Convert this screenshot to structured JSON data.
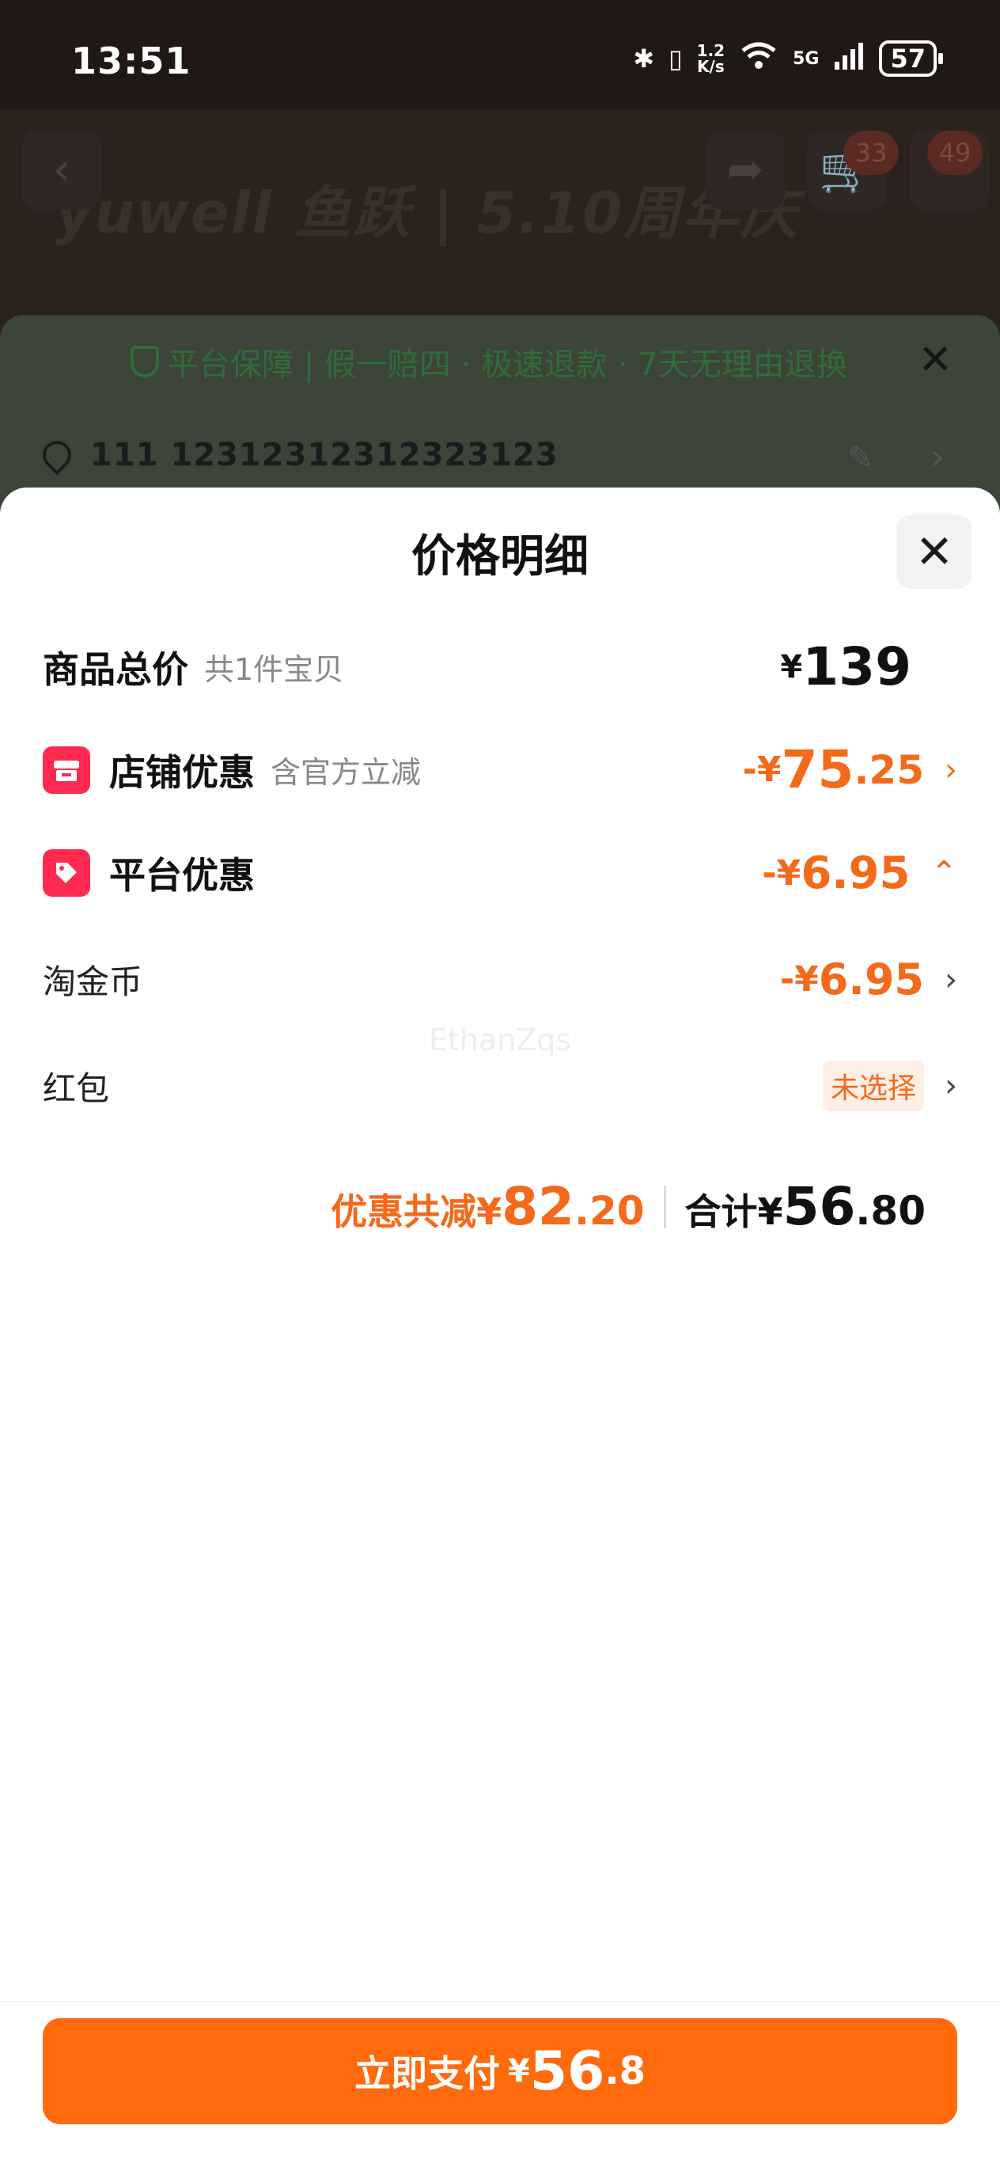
{
  "status_bar": {
    "time": "13:51",
    "net_speed_top": "1.2",
    "net_speed_bottom": "K/s",
    "network": "5G",
    "battery": "57",
    "icons": [
      "bluetooth-icon",
      "vibrate-icon",
      "wifi-icon",
      "signal-icon",
      "battery-icon"
    ]
  },
  "background_page": {
    "brand": "yuwell 鱼跃 | 5.10周年庆",
    "cart_badge": "33",
    "more_badge": "49",
    "guarantee": "平台保障 | 假一赔四 · 极速退款 · 7天无理由退换",
    "address": "111  12312312312323123"
  },
  "sheet": {
    "title": "价格明细",
    "rows": {
      "total": {
        "label": "商品总价",
        "sub": "共1件宝贝",
        "currency": "¥",
        "amount": "139"
      },
      "store": {
        "label": "店铺优惠",
        "sub": "含官方立减",
        "prefix": "-¥",
        "amount_int": "75",
        "amount_dec": ".25"
      },
      "platform": {
        "label": "平台优惠",
        "prefix": "-¥",
        "amount": "6.95"
      },
      "coins": {
        "label": "淘金币",
        "prefix": "-¥",
        "amount": "6.95"
      },
      "redpacket": {
        "label": "红包",
        "status": "未选择"
      }
    },
    "summary": {
      "discount_label": "优惠共减¥",
      "discount_int": "82",
      "discount_dec": ".20",
      "total_label": "合计¥",
      "total_int": "56",
      "total_dec": ".80"
    },
    "watermark": "EthanZqs"
  },
  "pay_button": {
    "label": "立即支付",
    "currency": "¥",
    "amount_int": "56",
    "amount_dec": ".8"
  },
  "colors": {
    "accent_orange": "#f46a1a",
    "pay_button": "#ff6a0d",
    "badge_red": "#ff2a4f"
  }
}
